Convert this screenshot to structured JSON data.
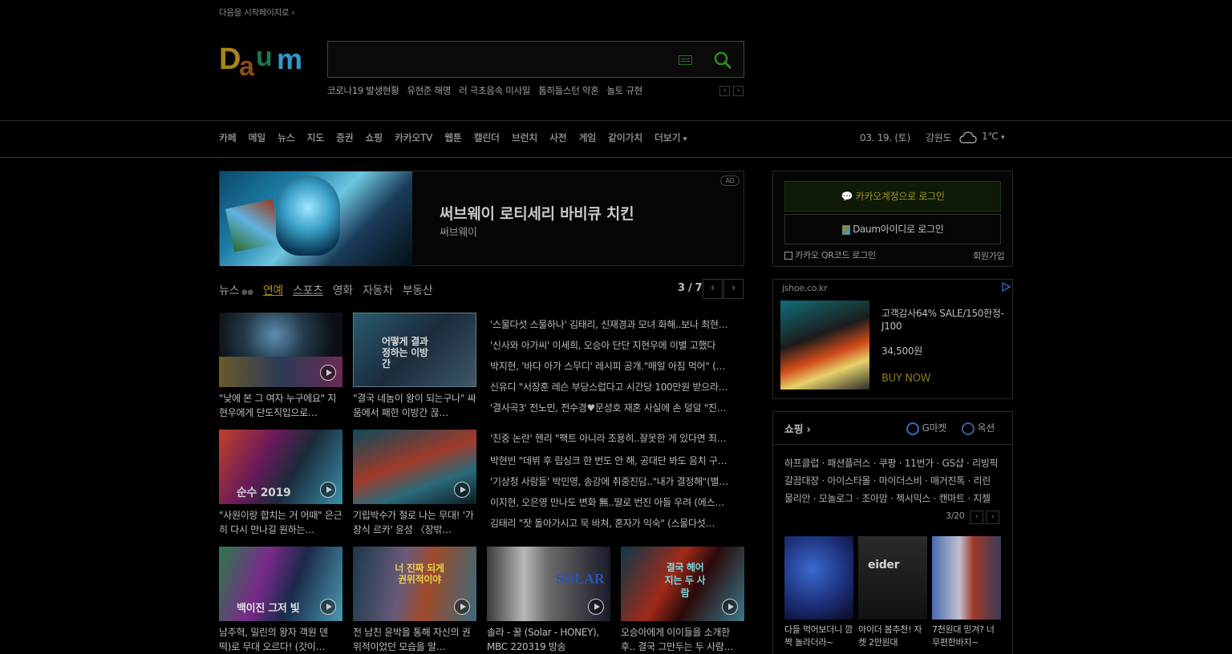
{
  "header": {
    "start_page": "다음을 시작페이지로 ›",
    "search_placeholder": "",
    "issues": [
      "코로나19 발생현황",
      "유현준 해명",
      "러 극초음속 미사일",
      "톰히들스턴 약혼",
      "놀토 규현"
    ]
  },
  "nav": {
    "items": [
      "카페",
      "메일",
      "뉴스",
      "지도",
      "증권",
      "쇼핑",
      "카카오TV",
      "웹툰",
      "캘린더",
      "브런치",
      "사전",
      "게임",
      "같이가치",
      "더보기"
    ],
    "date": "03. 19. (토)",
    "region": "강원도",
    "temp": "1℃"
  },
  "ad": {
    "title": "써브웨이 로티세리 바비큐 치킨",
    "sub": "써브웨이",
    "badge": "AD"
  },
  "news": {
    "tabs": [
      "뉴스",
      "연예",
      "스포츠",
      "영화",
      "자동차",
      "부동산"
    ],
    "page": "3 / 7",
    "row1_caps": [
      "\"낮에 본 그 여자 누구에요\" 지현우에게 단도직입으로…",
      "\"결국 네놈이 왕이 되는구나\" 싸움에서 패한 이방간 끊…"
    ],
    "row1_heads": [
      "'스물다섯 스물하나' 김태리, 신재경과 모녀 화해..보나 최현…",
      "'신사와 아가씨' 이세희, 오승아 단단 지현우에 이별 고했다",
      "박지현, '바다 아가 스무디' 레시피 공개.\"매일 아침 먹어\" (…",
      "신유디 \"서장훈 레슨 부당스럽다고 시간당 100만원 받으라…",
      "'결사곡3' 전노민, 전수경♥문성호 재혼 사실에 손 덜덜 \"진…"
    ],
    "row2_caps": [
      "\"사원이랑 합치는 거 어때\" 은근히 다시 만나길 원하는…",
      "기립박수가 절로 나는 무대! '가장식 르카' 윤성 〈장밖…"
    ],
    "row2_heads": [
      "'친중 논란' 헨리 \"팩트 아니라 조용히..잘못한 게 있다면 죄…",
      "박현빈 \"데뷔 후 립싱크 한 번도 안 해, 공대단 봐도 음치 구…",
      "'기상청 사람들' 박민영, 송강에 취중진담..\"내가 결정해\"(별…",
      "이지현, 오은영 만나도 변화 無..딸로 번진 아들 우려 (에스…",
      "김태리 \"잣 돌아가시고 묵 바쳐, 혼자가 익숙\" (스물다섯…"
    ],
    "row3_caps": [
      "남주혁, 밀린의 왕자 객원 덴 떡)로 무대 오르다! (갓이…",
      "전 남친 윤박을 통해 자신의 권위적이었던 모습을 알…",
      "솔라 - 꿀 (Solar - HONEY), MBC 220319 방송",
      "오승아에게 이이들을 소개한 후.. 결국 그만두는 두 사람…"
    ],
    "thumb_texts": [
      "",
      "어떻게 결과 정하는 이방간",
      "",
      "",
      "백이진 그저 빛",
      "너 진짜 되게 권위적이야",
      "SOLAR",
      "결국 헤어지는 두 사람"
    ]
  },
  "login": {
    "kakao": "카카오계정으로 로그인",
    "daum": "Daum아이디로 로그인",
    "qr": "카카오 QR코드 로그인",
    "join": "회원가입"
  },
  "shop_ad": {
    "domain": "jshoe.co.kr",
    "title": "고객감사64% SALE/150한정-J100",
    "price": "34,500원",
    "buy": "BUY NOW"
  },
  "shopping": {
    "title": "쇼핑 ›",
    "partner1": "G마켓",
    "partner2": "옥션",
    "links": [
      "하프클럽 · 패션플러스 · 쿠팡 · 11번가 · GS샵 · 리빙픽",
      "갈끔대장 · 아이스타몰 · 마이더스비 · 매거진톡 · 리린",
      "물리안 · 모놀로그 · 조아맘 · 젝시믹스 · 캔마트 · 지젤"
    ],
    "page": "3/20",
    "products": [
      "다들 먹어보더니 깜짝 놀라더라~",
      "아이더 봄추천! 자켓 2만원대",
      "7천원대 믿겨? 너무편한바지~"
    ]
  }
}
